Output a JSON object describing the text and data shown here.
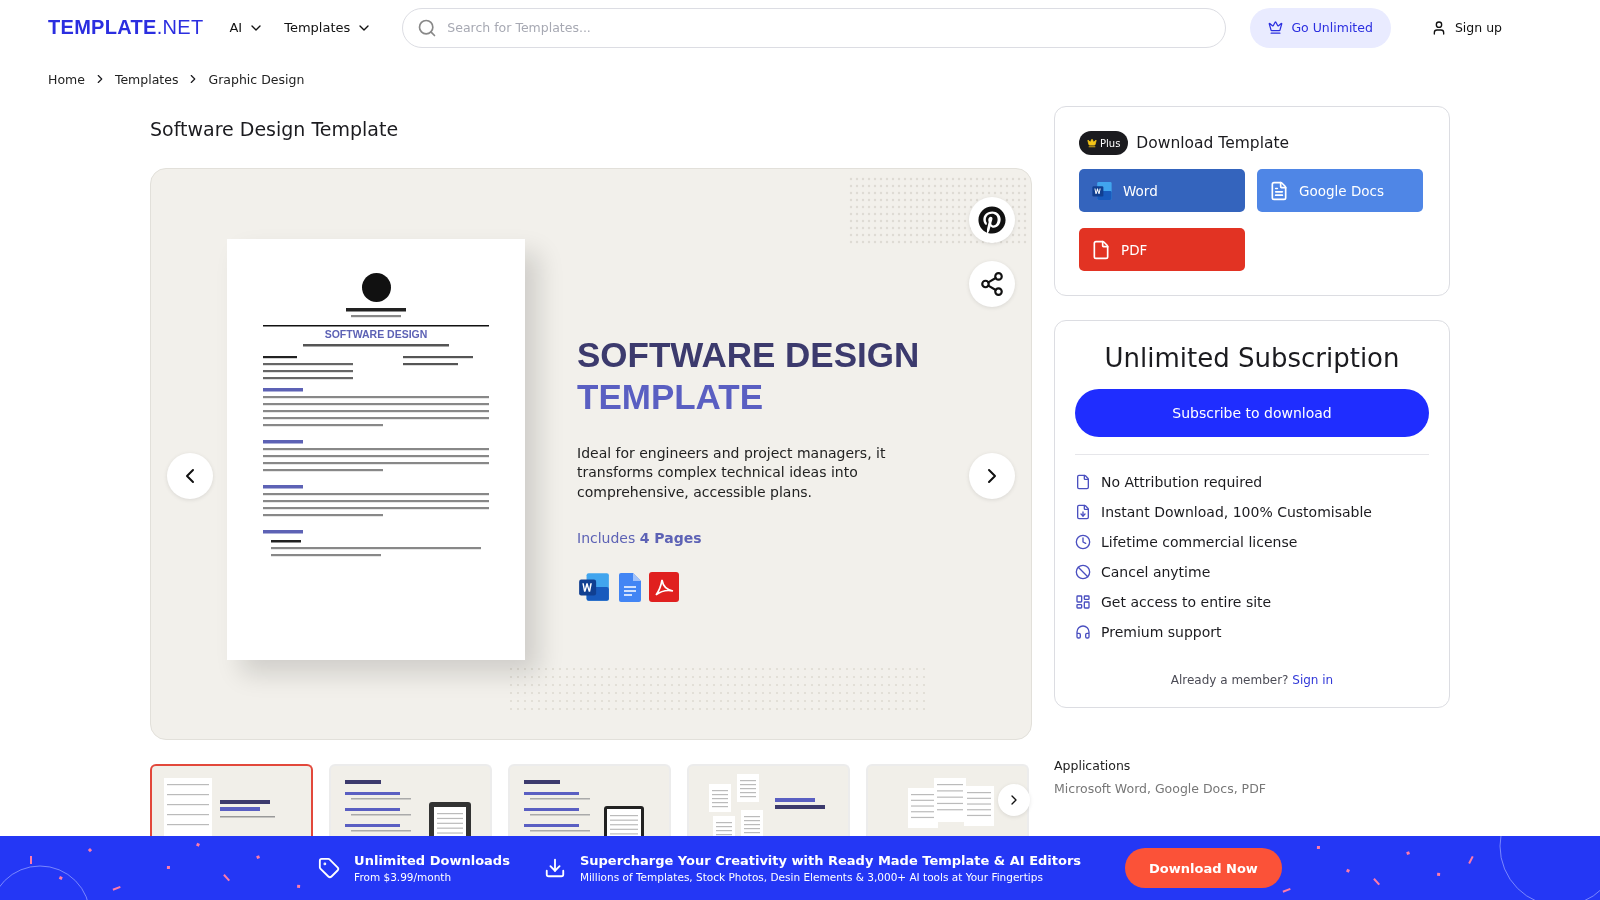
{
  "header": {
    "logo_bold": "TEMPLATE",
    "logo_light": ".NET",
    "nav": [
      {
        "label": "AI"
      },
      {
        "label": "Templates"
      }
    ],
    "search": {
      "placeholder": "Search for Templates..."
    },
    "go_unlimited": "Go Unlimited",
    "sign_up": "Sign up"
  },
  "breadcrumb": [
    "Home",
    "Templates",
    "Graphic Design"
  ],
  "page_title": "Software Design Template",
  "preview": {
    "document": {
      "title": "SOFTWARE DESIGN"
    },
    "headline_1": "SOFTWARE DESIGN",
    "headline_2": "TEMPLATE",
    "description": "Ideal for engineers and project managers, it transforms complex technical ideas into comprehensive, accessible plans.",
    "includes": "Includes **4 Pages**"
  },
  "thumbnails": [
    {
      "selected": true
    },
    {
      "selected": false
    },
    {
      "selected": false
    },
    {
      "selected": false
    },
    {
      "selected": false
    }
  ],
  "download": {
    "badge": "Plus",
    "title": "Download Template",
    "buttons": [
      {
        "kind": "word",
        "label": "Word"
      },
      {
        "kind": "docs",
        "label": "Google Docs"
      },
      {
        "kind": "pdf",
        "label": "PDF"
      }
    ]
  },
  "subscription": {
    "title": "Unlimited Subscription",
    "button": "Subscribe to download",
    "features": [
      {
        "kind": "file",
        "label": "No Attribution required"
      },
      {
        "kind": "download",
        "label": "Instant Download, 100% Customisable"
      },
      {
        "kind": "clock",
        "label": "Lifetime commercial license"
      },
      {
        "kind": "ban",
        "label": "Cancel anytime"
      },
      {
        "kind": "layout",
        "label": "Get access to entire site"
      },
      {
        "kind": "support",
        "label": "Premium support"
      }
    ],
    "member_text": "Already a member?",
    "sign_in": "Sign in"
  },
  "applications": {
    "label": "Applications",
    "value": "Microsoft Word, Google Docs, PDF"
  },
  "banner": {
    "offer_title": "Unlimited Downloads",
    "offer_sub": "From $3.99/month",
    "promo_title": "Supercharge Your Creativity with Ready Made Template & AI Editors",
    "promo_sub": "Millions of Templates, Stock Photos, Desin Elements & 3,000+ AI tools at Your Fingertips",
    "button": "Download Now"
  }
}
